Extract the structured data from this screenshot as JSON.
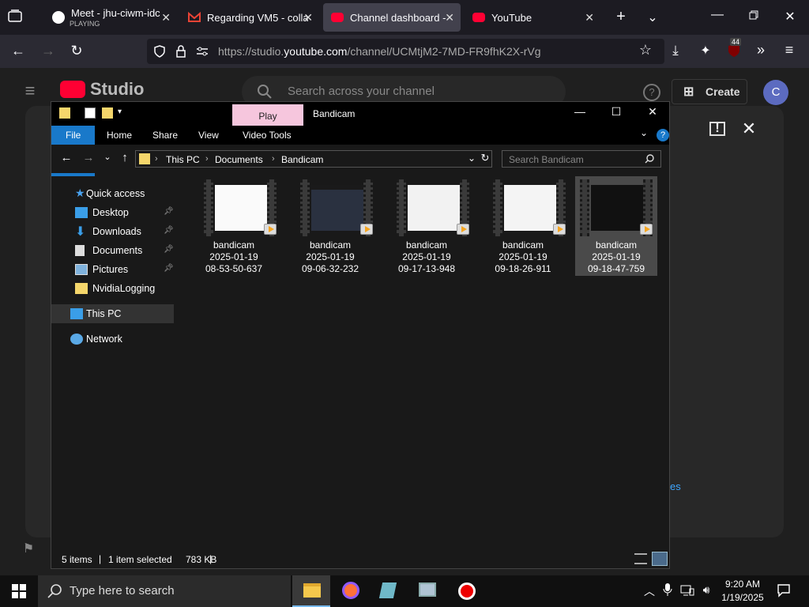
{
  "browser": {
    "tabs": [
      {
        "title": "Meet - jhu-ciwm-idc",
        "subtitle": "PLAYING"
      },
      {
        "title": "Regarding VM5 - colla"
      },
      {
        "title": "Channel dashboard - Y"
      },
      {
        "title": "YouTube"
      }
    ],
    "url_prefix": "https://studio.",
    "url_domain": "youtube.com",
    "url_path": "/channel/UCMtjM2-7MD-FR9fhK2X-rVg",
    "ext_badge": "44"
  },
  "studio": {
    "logo_text": "Studio",
    "search_placeholder": "Search across your channel",
    "create_label": "Create",
    "avatar_letter": "C",
    "dialog_link": "es"
  },
  "explorer": {
    "title": "Bandicam",
    "play_tab": "Play",
    "ribbon_tabs": [
      "File",
      "Home",
      "Share",
      "View",
      "Video Tools"
    ],
    "breadcrumb": [
      "This PC",
      "Documents",
      "Bandicam"
    ],
    "search_placeholder": "Search Bandicam",
    "nav": {
      "quick_access": "Quick access",
      "items": [
        "Desktop",
        "Downloads",
        "Documents",
        "Pictures",
        "NvidiaLogging"
      ],
      "this_pc": "This PC",
      "network": "Network"
    },
    "files": [
      {
        "name": "bandicam",
        "date": "2025-01-19",
        "time": "08-53-50-637"
      },
      {
        "name": "bandicam",
        "date": "2025-01-19",
        "time": "09-06-32-232"
      },
      {
        "name": "bandicam",
        "date": "2025-01-19",
        "time": "09-17-13-948"
      },
      {
        "name": "bandicam",
        "date": "2025-01-19",
        "time": "09-18-26-911"
      },
      {
        "name": "bandicam",
        "date": "2025-01-19",
        "time": "09-18-47-759"
      }
    ],
    "status": {
      "items": "5 items",
      "selected": "1 item selected",
      "size": "783 KB"
    }
  },
  "taskbar": {
    "search_placeholder": "Type here to search",
    "time": "9:20 AM",
    "date": "1/19/2025"
  }
}
